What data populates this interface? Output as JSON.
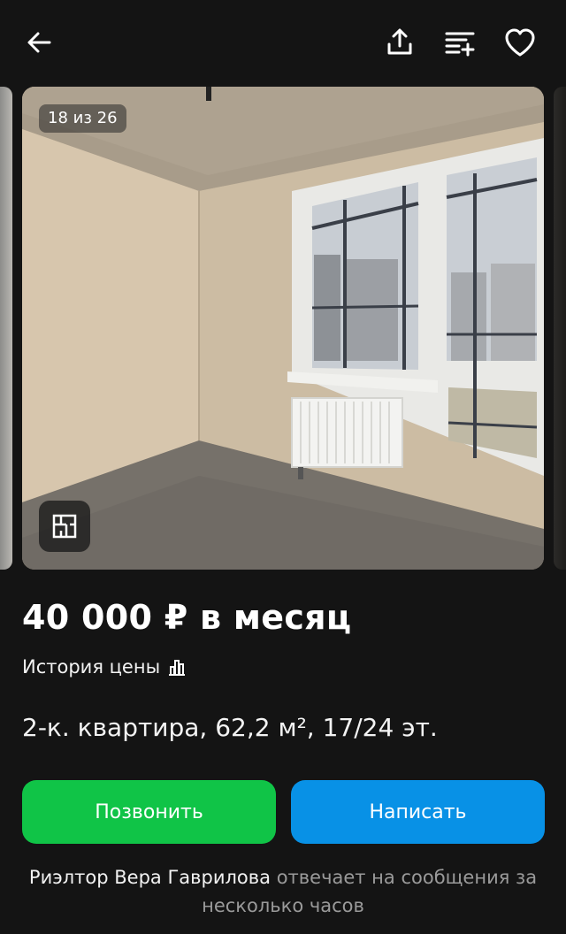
{
  "header": {
    "icons": [
      "back-arrow-icon",
      "share-icon",
      "compare-icon",
      "heart-icon"
    ]
  },
  "gallery": {
    "counter": "18 из 26",
    "current": 18,
    "total": 26,
    "floorplan_icon": "floorplan-icon"
  },
  "listing": {
    "price": "40 000 ₽ в месяц",
    "price_history_label": "История цены",
    "title": "2-к. квартира, 62,2 м², 17/24 эт."
  },
  "actions": {
    "call_label": "Позвонить",
    "write_label": "Написать",
    "call_color": "#10c447",
    "write_color": "#0891e6"
  },
  "footer": {
    "realtor": "Риэлтор Вера Гаврилова",
    "response": " отвечает на сообщения за несколько часов"
  }
}
